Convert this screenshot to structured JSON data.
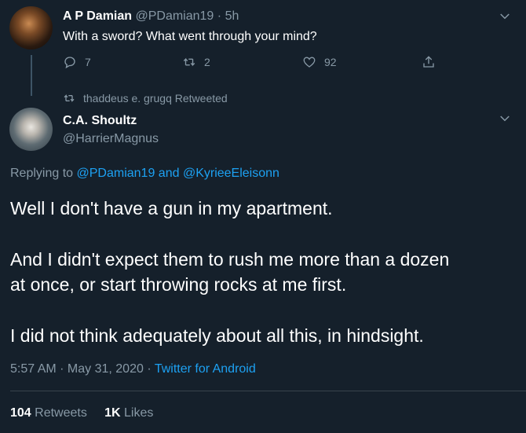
{
  "tweet1": {
    "name": "A P Damian",
    "handle": "@PDamian19",
    "separator": "·",
    "time": "5h",
    "text": "With a sword? What went through your mind?",
    "replies": "7",
    "retweets": "2",
    "likes": "92"
  },
  "retweet_banner": {
    "text": "thaddeus e. grugq Retweeted"
  },
  "tweet2": {
    "name": "C.A. Shoultz",
    "handle": "@HarrierMagnus",
    "replying_prefix": "Replying to",
    "replying_user1": "@PDamian19",
    "replying_and": "and",
    "replying_user2": "@KyrieeEleisonn",
    "body_line1": "Well I don't have a gun in my apartment.",
    "body_line2": "And I didn't expect them to rush me more than a dozen",
    "body_line3": "at once, or start throwing rocks at me first.",
    "body_line4": "I did not think adequately about all this, in hindsight.",
    "timestamp": "5:57 AM · May 31, 2020",
    "meta_separator": "·",
    "client": "Twitter for Android",
    "retweet_count": "104",
    "retweet_label": "Retweets",
    "like_count": "1K",
    "like_label": "Likes"
  },
  "colors": {
    "background": "#15202b",
    "muted": "#8899a6",
    "link": "#1da1f2",
    "divider": "#38444d"
  },
  "icons": [
    "reply-icon",
    "retweet-icon",
    "like-icon",
    "share-icon",
    "chevron-down-icon"
  ]
}
